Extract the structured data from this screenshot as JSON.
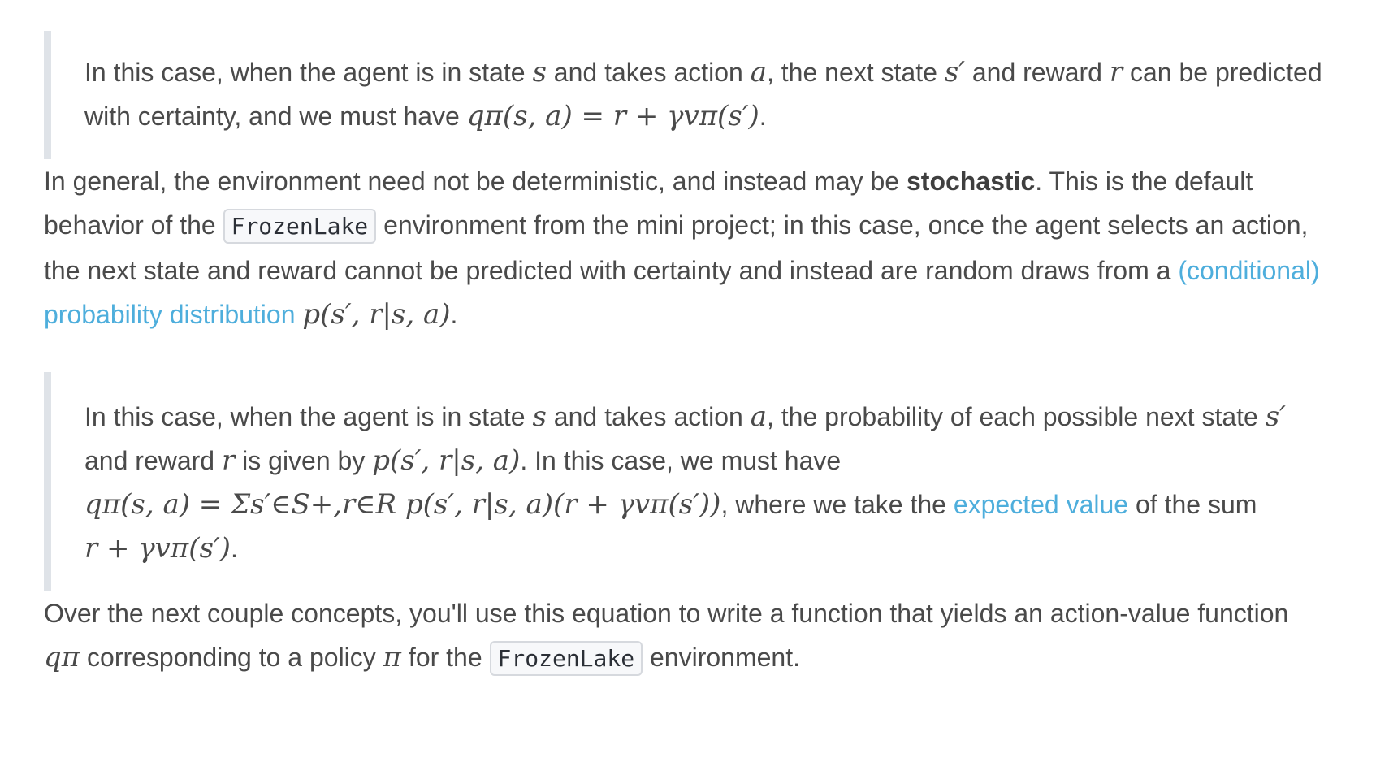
{
  "block1": {
    "t1": "In this case, when the agent is in state ",
    "m_s": "s",
    "t2": " and takes action ",
    "m_a": "a",
    "t3": ", the next state ",
    "m_sp": "s′",
    "t4": " and reward ",
    "m_r": "r",
    "t5": " can be predicted with certainty, and we must have ",
    "m_eq": "qπ(s, a) = r + γvπ(s′)",
    "t6": "."
  },
  "para1": {
    "t1": "In general, the environment need not be deterministic, and instead may be ",
    "bold": "stochastic",
    "t2": ". This is the default behavior of the ",
    "code": "FrozenLake",
    "t3": " environment from the mini project; in this case, once the agent selects an action, the next state and reward cannot be predicted with certainty and instead are random draws from a ",
    "link": "(conditional) probability distribution",
    "m_p": "p(s′, r|s, a)",
    "t4": "."
  },
  "block2": {
    "t1": "In this case, when the agent is in state ",
    "m_s": "s",
    "t2": " and takes action ",
    "m_a": "a",
    "t3": ", the probability of each possible next state ",
    "m_sp": "s′",
    "t4": " and reward ",
    "m_r": "r",
    "t5": " is given by ",
    "m_p": "p(s′, r|s, a)",
    "t6": ". In this case, we must have ",
    "m_eq": "qπ(s, a) = Σs′∈S+,r∈R p(s′, r|s, a)(r + γvπ(s′))",
    "t7": ", where we take the ",
    "link": "expected value",
    "t8": " of the sum ",
    "m_sum": "r + γvπ(s′)",
    "t9": "."
  },
  "para2": {
    "t1": "Over the next couple concepts, you'll use this equation to write a function that yields an action-value function ",
    "m_q": "qπ",
    "t2": " corresponding to a policy ",
    "m_pi": "π",
    "t3": " for the ",
    "code": "FrozenLake",
    "t4": " environment."
  },
  "colors": {
    "text": "#4a4a4a",
    "link": "#4eaedc",
    "quote_bar": "#dfe3e8",
    "code_bg": "#f7f8fa",
    "code_border": "#d6d9de"
  }
}
